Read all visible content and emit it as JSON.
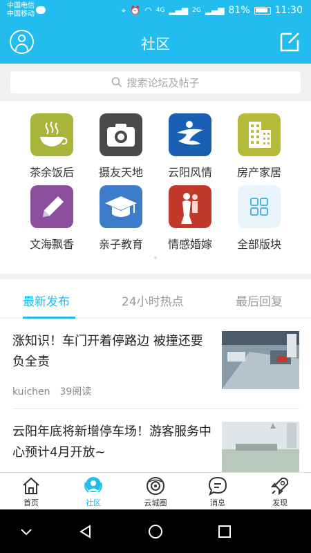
{
  "status_bar": {
    "carrier_1": "中国电信",
    "carrier_2": "中国移动",
    "network_1": "4G",
    "network_2": "2G",
    "battery": "81%",
    "time": "11:30"
  },
  "header": {
    "title": "社区",
    "accent_color": "#22bdee"
  },
  "search": {
    "placeholder": "搜索论坛及帖子"
  },
  "forums": [
    {
      "label": "茶余饭后",
      "icon": "coffee-cup-icon",
      "color": "#a9b53a"
    },
    {
      "label": "摄友天地",
      "icon": "camera-icon",
      "color": "#4a4a4a"
    },
    {
      "label": "云阳风情",
      "icon": "yunyang-logo-icon",
      "color": "#1a5fb4"
    },
    {
      "label": "房产家居",
      "icon": "building-icon",
      "color": "#b6ba3a"
    },
    {
      "label": "文海飘香",
      "icon": "pencil-icon",
      "color": "#8b4f9e"
    },
    {
      "label": "亲子教育",
      "icon": "graduation-cap-icon",
      "color": "#3d7cc9"
    },
    {
      "label": "情感婚嫁",
      "icon": "couple-icon",
      "color": "#c0392b"
    },
    {
      "label": "全部版块",
      "icon": "grid-icon",
      "color": "#e8f4fb"
    }
  ],
  "tabs": [
    {
      "label": "最新发布",
      "active": true
    },
    {
      "label": "24小时热点",
      "active": false
    },
    {
      "label": "最后回复",
      "active": false
    }
  ],
  "posts": [
    {
      "title": "涨知识！车门开着停路边 被撞还要负全责",
      "author": "kuichen",
      "views": "39阅读",
      "thumb": "cctv-street-photo"
    },
    {
      "title": "云阳年底将新增停车场！游客服务中心预计4月开放~",
      "thumb": "riverside-building-photo"
    }
  ],
  "bottom_nav": [
    {
      "label": "首页",
      "icon": "home-icon",
      "active": false
    },
    {
      "label": "社区",
      "icon": "community-icon",
      "active": true
    },
    {
      "label": "云城圈",
      "icon": "circle-camera-icon",
      "active": false
    },
    {
      "label": "消息",
      "icon": "message-icon",
      "active": false
    },
    {
      "label": "发现",
      "icon": "rocket-icon",
      "active": false
    }
  ]
}
